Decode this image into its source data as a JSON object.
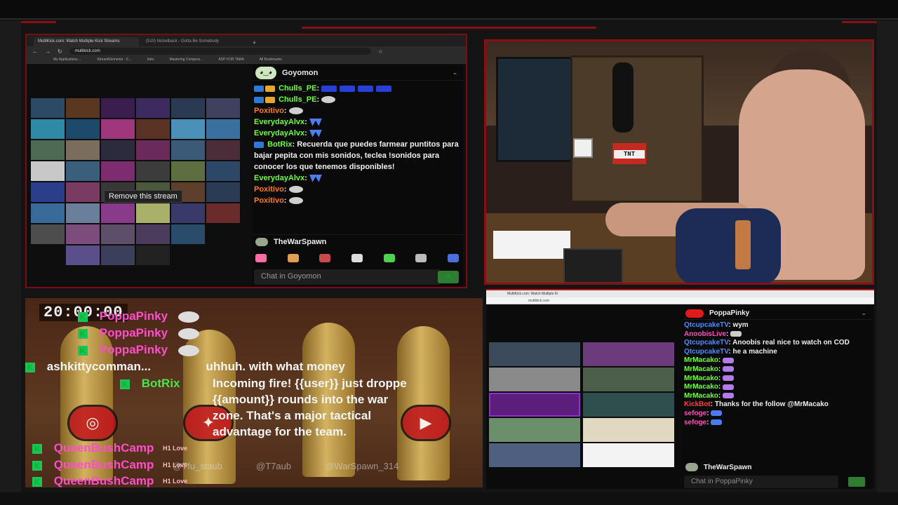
{
  "overlay": {
    "accent_color": "#8a0e12"
  },
  "browser1": {
    "tabs": [
      {
        "label": "MultiKick.com: Watch Multiple Kick Streams"
      },
      {
        "label": "(510) Nickelback - Gotta Be Somebody"
      }
    ],
    "new_tab_icon": "plus-icon",
    "url": "multikick.com",
    "bookmarks": [
      "My Applications ...",
      "StreamElements - C...",
      "Intro",
      "Mastering Compres...",
      "ADP FOR TARA",
      "All Bookmarks"
    ],
    "tooltip": "Remove this stream"
  },
  "chat1": {
    "channel": "Goyomon",
    "messages": [
      {
        "user": "Chulls_PE",
        "text": "",
        "user_color": "green"
      },
      {
        "user": "Chulls_PE",
        "text": "",
        "user_color": "green"
      },
      {
        "user": "Poxitivo",
        "text": "",
        "user_color": "orange"
      },
      {
        "user": "EverydayAlvx",
        "text": "",
        "user_color": "green"
      },
      {
        "user": "EverydayAlvx",
        "text": "",
        "user_color": "green"
      },
      {
        "user": "BotRix",
        "text": "Recuerda que puedes farmear puntitos para bajar pepita con mis sonidos, teclea !sonidos para conocer los que tenemos disponibles!",
        "user_color": "green"
      },
      {
        "user": "EverydayAlvx",
        "text": "",
        "user_color": "green"
      },
      {
        "user": "Poxitivo",
        "text": "",
        "user_color": "orange"
      },
      {
        "user": "Poxitivo",
        "text": "",
        "user_color": "orange"
      }
    ],
    "current_user": "TheWarSpawn",
    "input_placeholder": "Chat in Goyomon"
  },
  "alert_panel": {
    "timer": "20:00:00",
    "rows": [
      {
        "user": "PoppaPinky",
        "text": ""
      },
      {
        "user": "PoppaPinky",
        "text": ""
      },
      {
        "user": "PoppaPinky",
        "text": ""
      },
      {
        "user": "ashkittycomman...",
        "text": "uhhuh. with what money"
      },
      {
        "user": "BotRix",
        "text": "Incoming fire! {{user}} just dropped {{amount}} rounds into the war zone. That's a major tactical advantage for the team."
      },
      {
        "user": "QueenBushCamp",
        "text": ""
      },
      {
        "user": "QueenBushCamp",
        "text": ""
      },
      {
        "user": "QueenBushCamp",
        "text": ""
      }
    ],
    "love_label": "H1 Love",
    "botrix_lines": [
      "Incoming fire! {{user}} just droppe",
      "{{amount}} rounds into the war",
      "zone. That's a major tactical",
      "advantage for the team."
    ],
    "social_tags": [
      "@Tfu_staub",
      "@T7aub",
      "@WarSpawn_314"
    ]
  },
  "browser2": {
    "tab": "MultiKick.com: Watch Multiple Ki",
    "url": "multikick.com"
  },
  "chat2": {
    "channel": "PoppaPinky",
    "messages": [
      {
        "user": "QtcupcakeTV",
        "text": "wym",
        "color": "blue"
      },
      {
        "user": "AnoobisLive",
        "text": "",
        "color": "pink"
      },
      {
        "user": "QtcupcakeTV",
        "text": "Anoobis real nice to watch on COD",
        "color": "blue"
      },
      {
        "user": "QtcupcakeTV",
        "text": "he a machine",
        "color": "blue"
      },
      {
        "user": "MrMacako",
        "text": "",
        "color": "green"
      },
      {
        "user": "MrMacako",
        "text": "",
        "color": "green"
      },
      {
        "user": "MrMacako",
        "text": "",
        "color": "green"
      },
      {
        "user": "MrMacako",
        "text": "",
        "color": "green"
      },
      {
        "user": "MrMacako",
        "text": "",
        "color": "green"
      },
      {
        "user": "KickBot",
        "text": "Thanks for the follow @MrMacako",
        "color": "red"
      },
      {
        "user": "sefoge",
        "text": "",
        "color": "pink"
      },
      {
        "user": "sefoge",
        "text": "",
        "color": "pink"
      }
    ],
    "current_user": "TheWarSpawn",
    "input_placeholder": "Chat in PoppaPinky"
  }
}
